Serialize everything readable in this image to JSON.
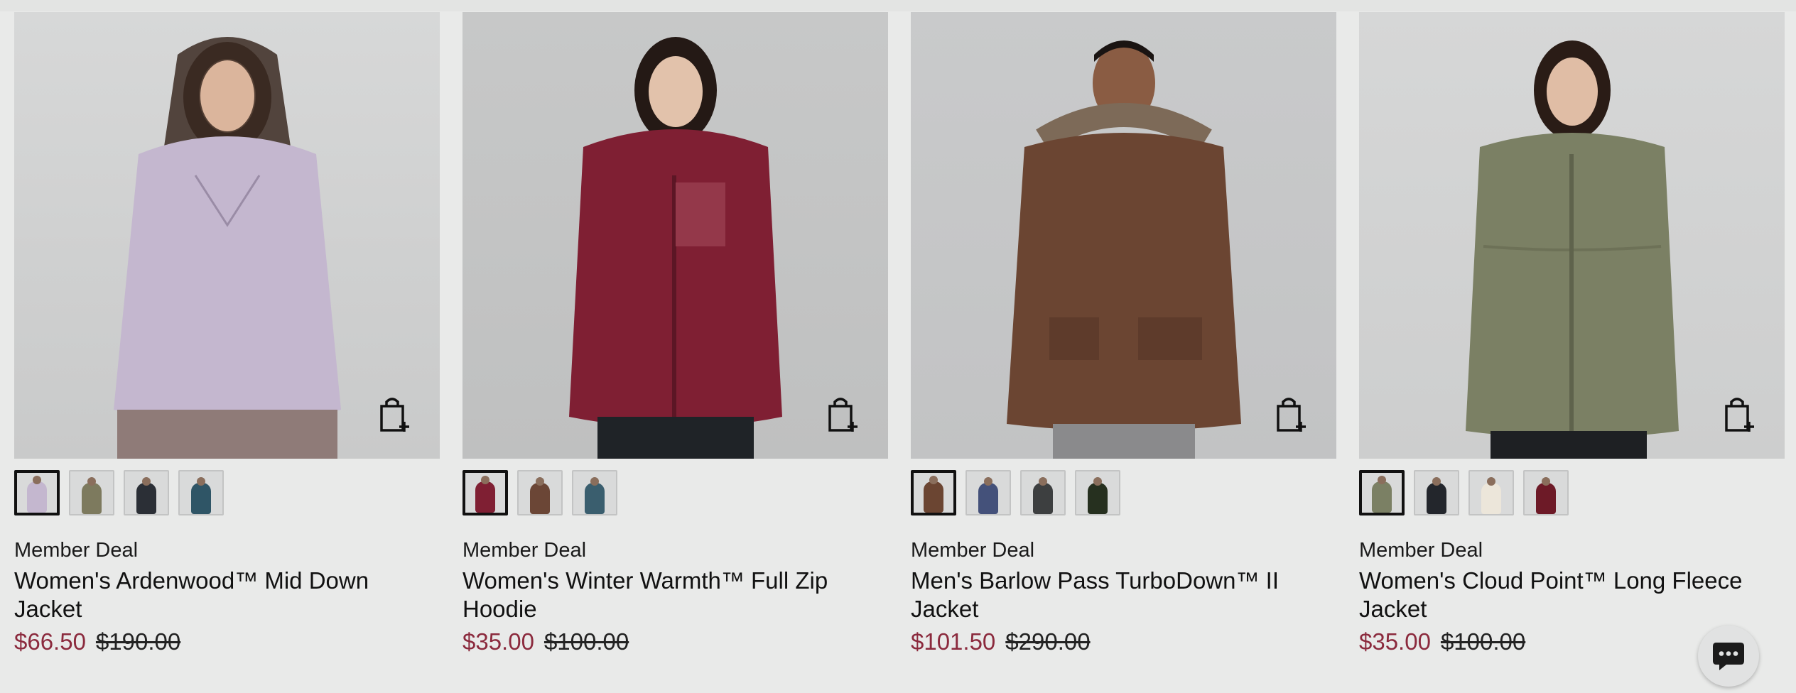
{
  "products": [
    {
      "deal": "Member Deal",
      "title": "Women's Ardenwood™ Mid Down Jacket",
      "sale_price": "$66.50",
      "original_price": "$190.00",
      "jacket_color": "#c4b7cf",
      "swatches": [
        "#c4b7cf",
        "#7d7a5e",
        "#2b2f36",
        "#2f5566"
      ]
    },
    {
      "deal": "Member Deal",
      "title": "Women's Winter Warmth™ Full Zip Hoodie",
      "sale_price": "$35.00",
      "original_price": "$100.00",
      "jacket_color": "#7f1f33",
      "swatches": [
        "#7f1f33",
        "#6b4636",
        "#3a5e6e"
      ]
    },
    {
      "deal": "Member Deal",
      "title": "Men's Barlow Pass TurboDown™ II Jacket",
      "sale_price": "$101.50",
      "original_price": "$290.00",
      "jacket_color": "#6b4532",
      "swatches": [
        "#6b4532",
        "#44517a",
        "#3d3f40",
        "#26301f"
      ]
    },
    {
      "deal": "Member Deal",
      "title": "Women's Cloud Point™ Long Fleece Jacket",
      "sale_price": "$35.00",
      "original_price": "$100.00",
      "jacket_color": "#7b8064",
      "swatches": [
        "#7b8064",
        "#23262c",
        "#ece6da",
        "#6d1a27"
      ]
    }
  ],
  "colors": {
    "sale_price": "#8b2a3d",
    "background": "#e9eae9"
  },
  "icons": {
    "add_to_bag": "shopping-bag-plus-icon",
    "chat": "chat-bubble-icon"
  }
}
